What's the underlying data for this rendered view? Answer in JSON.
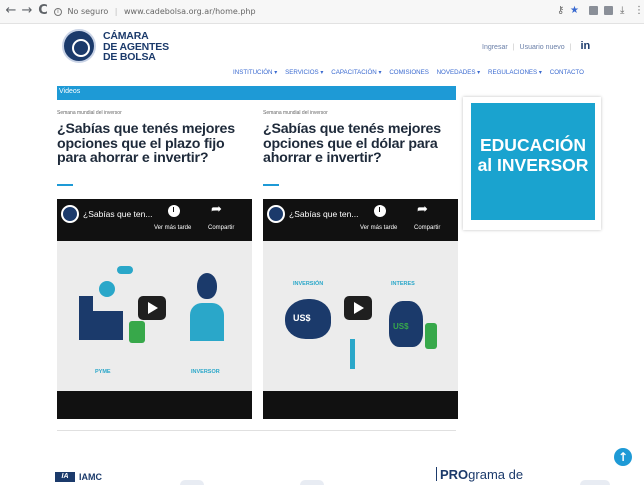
{
  "browser": {
    "back_icon": "←",
    "forward_icon": "→",
    "reload_icon": "C",
    "security_label": "No seguro",
    "url": "www.cadebolsa.org.ar/home.php",
    "info_icon": "i"
  },
  "header": {
    "logo_lines": [
      "CÁMARA",
      "DE AGENTES",
      "DE BOLSA"
    ],
    "utility": {
      "login": "Ingresar",
      "register": "Usuario nuevo",
      "linkedin": "in"
    },
    "nav": [
      "INSTITUCIÓN ▾",
      "SERVICIOS ▾",
      "CAPACITACIÓN ▾",
      "COMISIONES",
      "NOVEDADES ▾",
      "REGULACIONES ▾",
      "CONTACTO"
    ]
  },
  "videos_section": {
    "label": "Videos"
  },
  "articles": [
    {
      "kicker": "Semana mundial del inversor",
      "headline": "¿Sabías que tenés mejores opciones que el plazo fijo para ahorrar e invertir?",
      "video": {
        "title": "¿Sabías que ten...",
        "watch_later": "Ver más tarde",
        "share": "Compartir",
        "labels": [
          "PYME",
          "INVERSOR"
        ]
      }
    },
    {
      "kicker": "Semana mundial del inversor",
      "headline": "¿Sabías que tenés mejores opciones que el dólar para ahorrar e invertir?",
      "video": {
        "title": "¿Sabías que ten...",
        "watch_later": "Ver más tarde",
        "share": "Compartir",
        "labels": [
          "INVERSIÓN",
          "INTERES",
          "US$",
          "US$"
        ]
      }
    }
  ],
  "sidebar": {
    "banner_line1": "EDUCACIÓN",
    "banner_line2": "al INVERSOR"
  },
  "footer": {
    "iamc_mark": "IA",
    "iamc_text": "IAMC",
    "program_bold": "PRO",
    "program_rest": "grama de",
    "scroll_top_icon": "↑"
  },
  "colors": {
    "brand_navy": "#1b3a6b",
    "accent_blue": "#1e9ad6",
    "banner": "#1aa3cf",
    "link": "#3a6ad0"
  }
}
